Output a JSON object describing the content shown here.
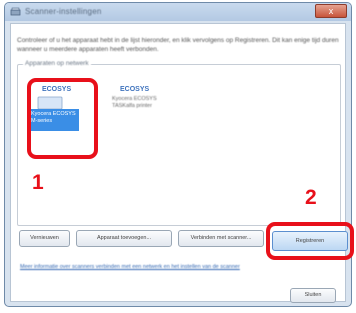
{
  "window": {
    "title": "Scanner-instellingen",
    "close_glyph": "x"
  },
  "main": {
    "description": "Controleer of u het apparaat hebt in de lijst hieronder, en klik vervolgens op Registreren. Dit kan enige tijd duren wanneer u meerdere apparaten heeft verbonden.",
    "group_label": "Apparaten op netwerk",
    "devices": [
      {
        "icon_label": " ECOSYS",
        "caption": "Kyocera ECOSYS M-series"
      },
      {
        "icon_label": "ECOSYS",
        "caption": "Kyocera ECOSYS\nTASKalfa printer"
      }
    ]
  },
  "buttons": [
    {
      "label": "Vernieuwen"
    },
    {
      "label": "Apparaat toevoegen..."
    },
    {
      "label": "Verbinden met scanner..."
    },
    {
      "label": "Registreren"
    }
  ],
  "link": {
    "label": "Meer informatie over scanners verbinden met een netwerk en het instellen van de scanner"
  },
  "bottom": {
    "close_label": "Sluiten"
  },
  "annotations": [
    {
      "label": "1"
    },
    {
      "label": "2"
    }
  ],
  "colors": {
    "highlight_red": "#e8101a",
    "selection_blue": "#3a8ee6",
    "accent_blue": "#3f73bd"
  }
}
